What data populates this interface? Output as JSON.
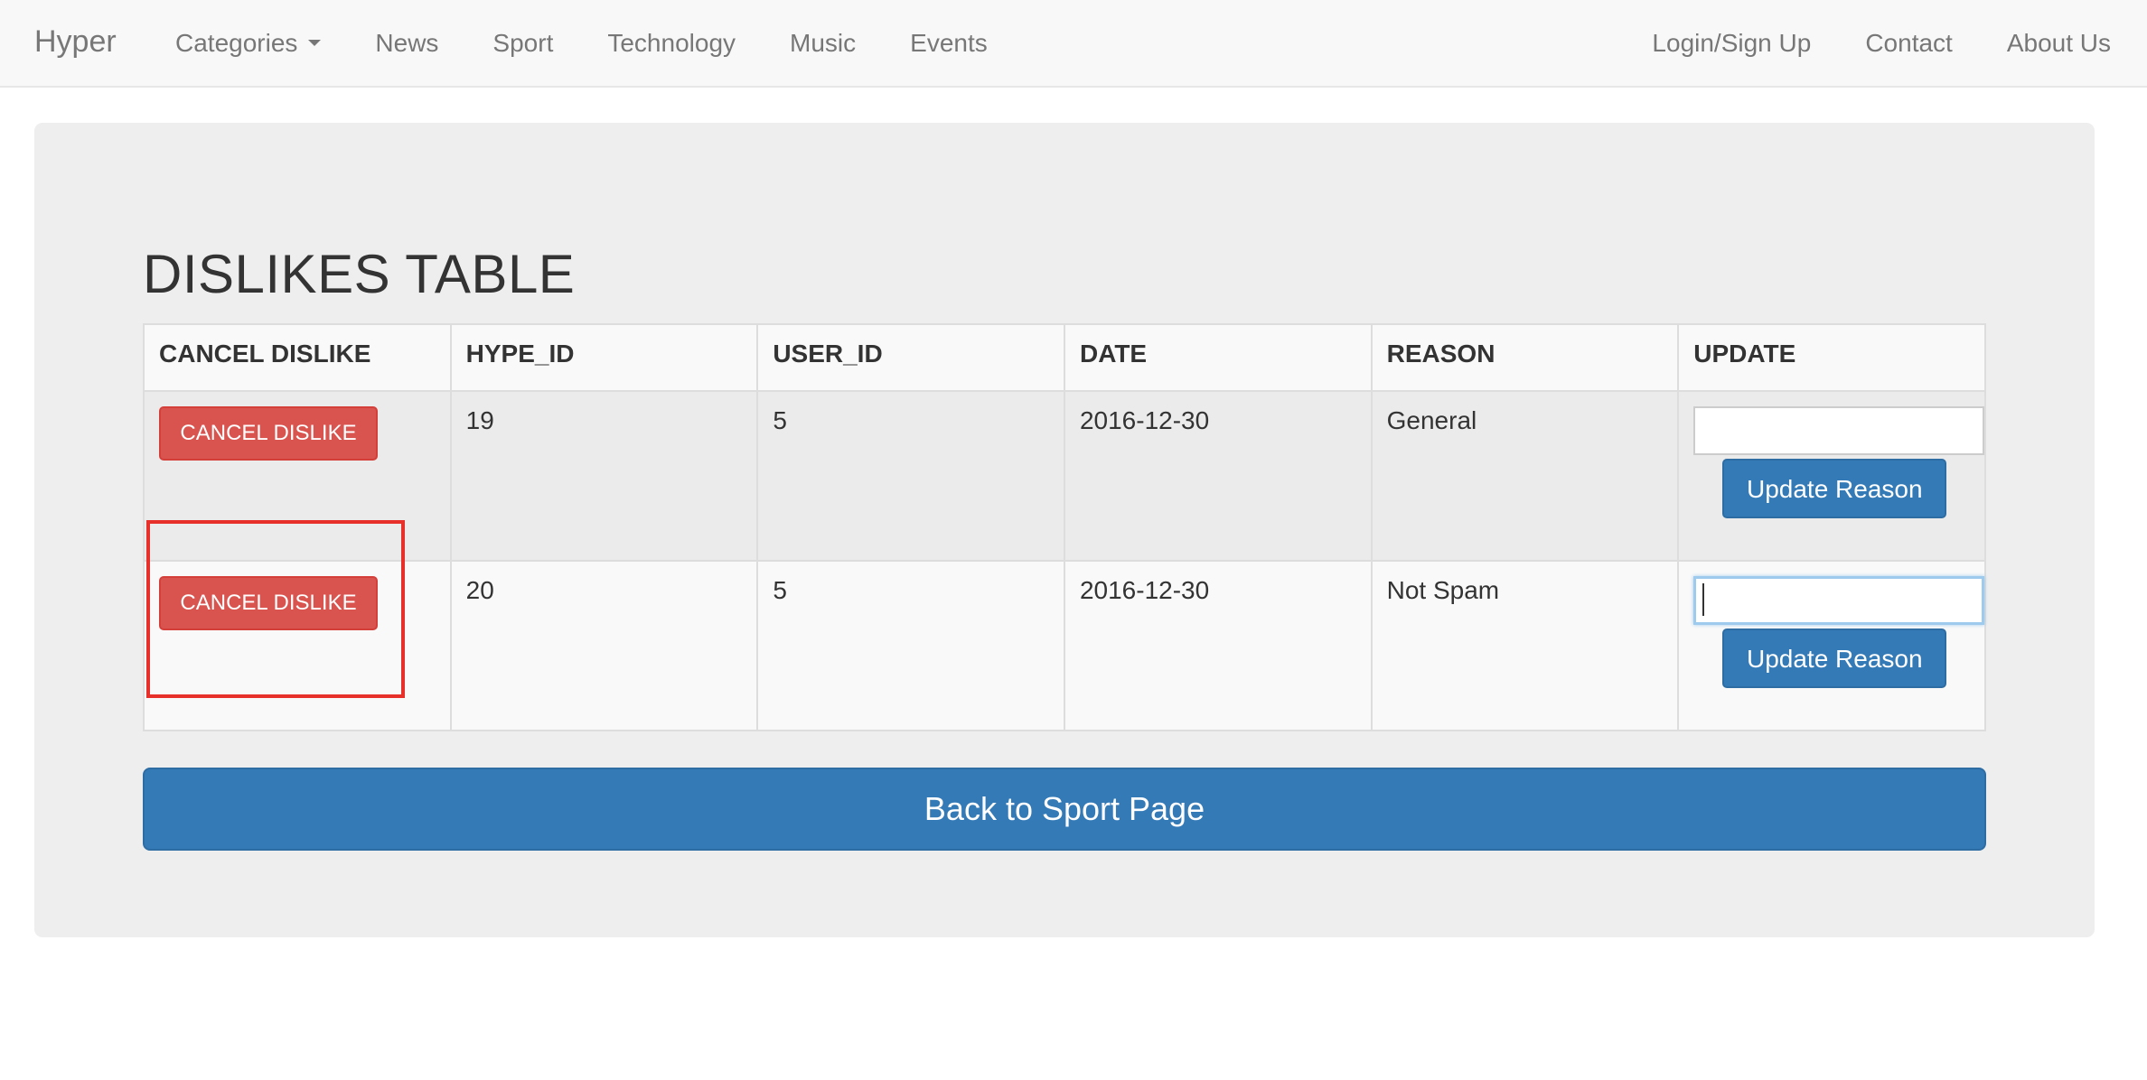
{
  "navbar": {
    "brand": "Hyper",
    "left_items": [
      {
        "label": "Categories",
        "has_caret": true
      },
      {
        "label": "News"
      },
      {
        "label": "Sport"
      },
      {
        "label": "Technology"
      },
      {
        "label": "Music"
      },
      {
        "label": "Events"
      }
    ],
    "right_items": [
      {
        "label": "Login/Sign Up"
      },
      {
        "label": "Contact"
      },
      {
        "label": "About Us"
      }
    ]
  },
  "main": {
    "title": "DISLIKES TABLE",
    "table": {
      "headers": [
        "CANCEL DISLIKE",
        "HYPE_ID",
        "USER_ID",
        "DATE",
        "REASON",
        "UPDATE"
      ],
      "rows": [
        {
          "cancel_label": "CANCEL DISLIKE",
          "hype_id": "19",
          "user_id": "5",
          "date": "2016-12-30",
          "reason": "General",
          "input_value": "",
          "update_label": "Update Reason"
        },
        {
          "cancel_label": "CANCEL DISLIKE",
          "hype_id": "20",
          "user_id": "5",
          "date": "2016-12-30",
          "reason": "Not Spam",
          "input_value": "",
          "update_label": "Update Reason"
        }
      ]
    },
    "back_button": "Back to Sport Page"
  },
  "colors": {
    "danger": "#d9534f",
    "primary": "#337ab7",
    "highlight": "#e8302a"
  },
  "highlight": {
    "target": "row-2-cancel-dislike-button",
    "color": "#e8302a"
  }
}
